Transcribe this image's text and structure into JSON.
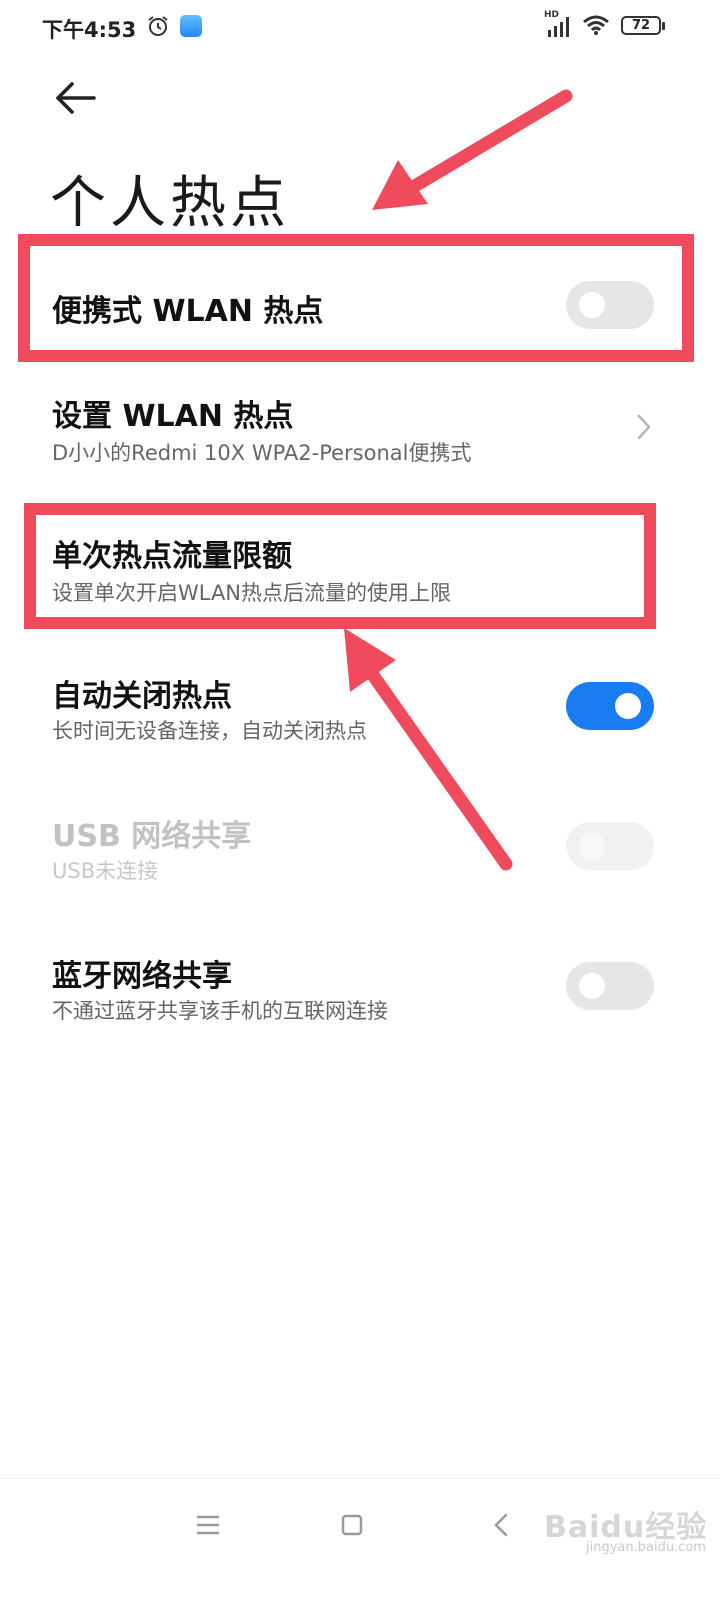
{
  "status_bar": {
    "time": "下午4:53",
    "network_label": "HD",
    "battery_level": "72",
    "icons": [
      "alarm-icon",
      "app-notification-icon",
      "signal-icon",
      "wifi-icon",
      "battery-icon"
    ]
  },
  "header": {
    "back_icon": "back-arrow-icon",
    "title": "个人热点"
  },
  "settings": [
    {
      "title": "便携式 WLAN 热点",
      "subtitle": "",
      "control": "toggle",
      "state": "off",
      "enabled": true
    },
    {
      "title": "设置 WLAN 热点",
      "subtitle": "D小小的Redmi 10X WPA2-Personal便携式",
      "control": "chevron",
      "enabled": true
    },
    {
      "title": "单次热点流量限额",
      "subtitle": "设置单次开启WLAN热点后流量的使用上限",
      "control": "none",
      "enabled": true
    },
    {
      "title": "自动关闭热点",
      "subtitle": "长时间无设备连接，自动关闭热点",
      "control": "toggle",
      "state": "on",
      "enabled": true
    },
    {
      "title": "USB 网络共享",
      "subtitle": "USB未连接",
      "control": "toggle",
      "state": "off",
      "enabled": false
    },
    {
      "title": "蓝牙网络共享",
      "subtitle": "不通过蓝牙共享该手机的互联网连接",
      "control": "toggle",
      "state": "off",
      "enabled": true
    }
  ],
  "nav_bar": {
    "icons": [
      "menu-icon",
      "home-icon",
      "back-icon"
    ]
  },
  "watermark": {
    "main": "Baidu经验",
    "sub": "jingyan.baidu.com"
  },
  "colors": {
    "toggle_on": "#1a7cf2",
    "toggle_off": "#e6e6e6",
    "highlight": "#f04a5d"
  }
}
